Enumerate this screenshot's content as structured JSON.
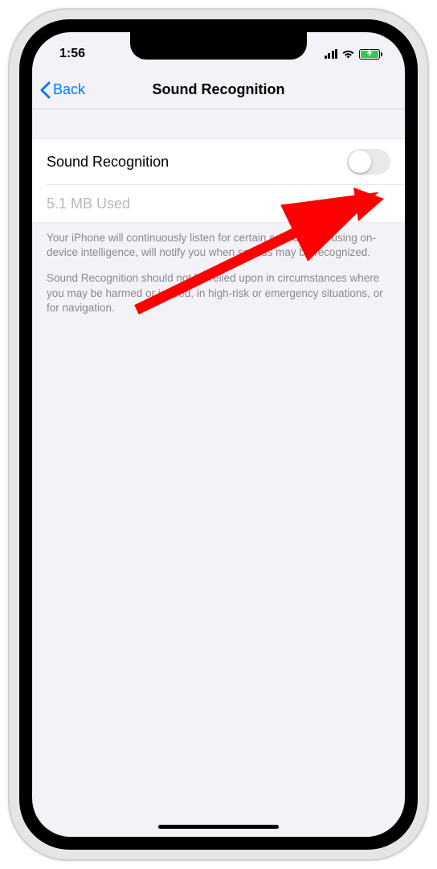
{
  "status": {
    "time": "1:56"
  },
  "nav": {
    "back_label": "Back",
    "title": "Sound Recognition"
  },
  "settings": {
    "toggle_label": "Sound Recognition",
    "toggle_on": false,
    "storage_text": "5.1 MB Used"
  },
  "footer": {
    "p1": "Your iPhone will continuously listen for certain sounds, and using on-device intelligence, will notify you when sounds may be recognized.",
    "p2": "Sound Recognition should not be relied upon in circumstances where you may be harmed or injured, in high-risk or emergency situations, or for navigation."
  }
}
